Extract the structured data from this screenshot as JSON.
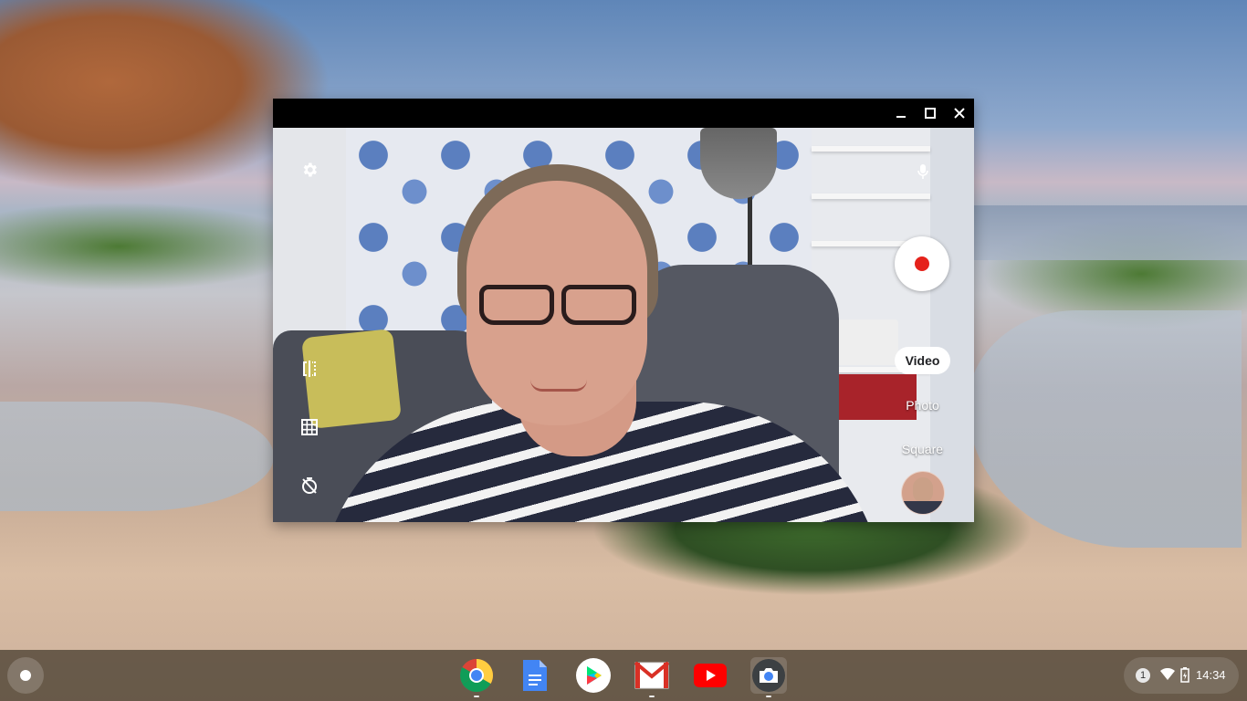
{
  "window": {
    "controls": {
      "minimize_icon": "minimize-icon",
      "maximize_icon": "maximize-icon",
      "close_icon": "close-icon"
    }
  },
  "camera": {
    "left_controls": [
      "settings-icon",
      "mirror-icon",
      "grid-icon",
      "timer-icon"
    ],
    "mic_icon": "microphone-icon",
    "shutter_mode": "record",
    "modes": [
      "Video",
      "Photo",
      "Square"
    ],
    "active_mode": "Video"
  },
  "shelf": {
    "apps": [
      {
        "name": "Chrome",
        "icon": "chrome-icon",
        "running": true
      },
      {
        "name": "Docs",
        "icon": "docs-icon",
        "running": false
      },
      {
        "name": "Play Store",
        "icon": "play-store-icon",
        "running": false
      },
      {
        "name": "Gmail",
        "icon": "gmail-icon",
        "running": true
      },
      {
        "name": "YouTube",
        "icon": "youtube-icon",
        "running": false
      },
      {
        "name": "Camera",
        "icon": "camera-icon",
        "running": true
      }
    ],
    "tray": {
      "notification_count": "1",
      "time": "14:34"
    }
  },
  "colors": {
    "record_red": "#e5221b",
    "shelf": "#463c2d"
  }
}
